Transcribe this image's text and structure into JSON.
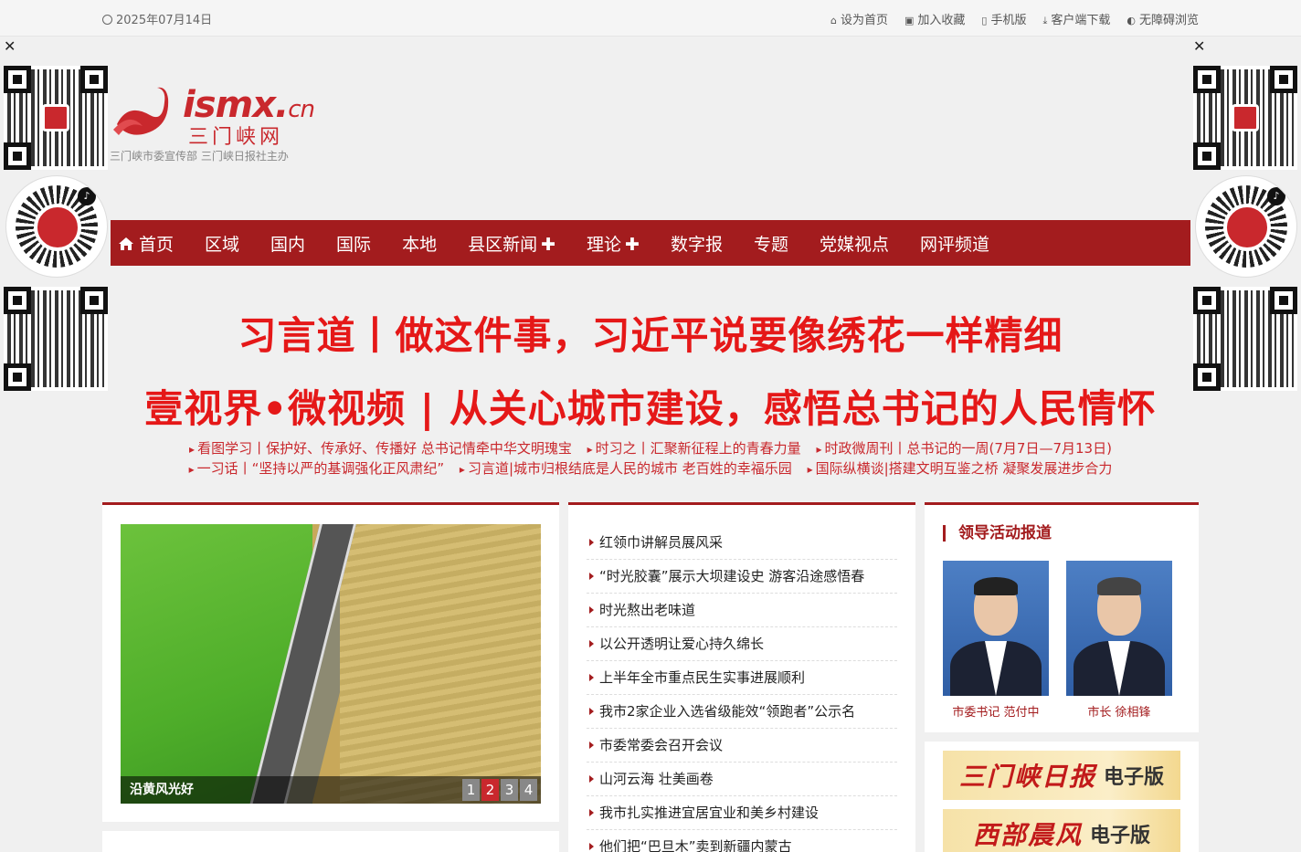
{
  "topbar": {
    "date": "2025年07月14日",
    "links": [
      {
        "label": "设为首页",
        "icon": "home-icon"
      },
      {
        "label": "加入收藏",
        "icon": "bookmark-icon"
      },
      {
        "label": "手机版",
        "icon": "mobile-icon"
      },
      {
        "label": "客户端下载",
        "icon": "download-icon"
      },
      {
        "label": "无障碍浏览",
        "icon": "accessibility-icon"
      }
    ]
  },
  "side": {
    "close": "✕"
  },
  "logo": {
    "wordmark": "ismx.",
    "tld": "cn",
    "name": "三门峡网",
    "slogan": "三门峡市委宣传部  三门峡日报社主办"
  },
  "nav": {
    "items": [
      {
        "label": "首页",
        "has_plus": false
      },
      {
        "label": "区域",
        "has_plus": false
      },
      {
        "label": "国内",
        "has_plus": false
      },
      {
        "label": "国际",
        "has_plus": false
      },
      {
        "label": "本地",
        "has_plus": false
      },
      {
        "label": "县区新闻",
        "has_plus": true
      },
      {
        "label": "理论",
        "has_plus": true
      },
      {
        "label": "数字报",
        "has_plus": false
      },
      {
        "label": "专题",
        "has_plus": false
      },
      {
        "label": "党媒视点",
        "has_plus": false
      },
      {
        "label": "网评频道",
        "has_plus": false
      }
    ],
    "plus_glyph": "✚"
  },
  "headlines": {
    "h1": "习言道丨做这件事，习近平说要像绣花一样精细",
    "h2": "壹视界•微视频 | 从关心城市建设，感悟总书记的人民情怀"
  },
  "ticker": [
    "看图学习丨保护好、传承好、传播好 总书记情牵中华文明瑰宝",
    "时习之丨汇聚新征程上的青春力量",
    "时政微周刊丨总书记的一周(7月7日—7月13日)",
    "一习话丨“坚持以严的基调强化正风肃纪”",
    "习言道|城市归根结底是人民的城市 老百姓的幸福乐园",
    "国际纵横谈|搭建文明互鉴之桥 凝聚发展进步合力"
  ],
  "slider": {
    "caption": "沿黄风光好",
    "pages": [
      "1",
      "2",
      "3",
      "4"
    ],
    "active_page": 2
  },
  "news": [
    "红领巾讲解员展风采",
    "“时光胶囊”展示大坝建设史 游客沿途感悟春",
    "时光熬出老味道",
    "以公开透明让爱心持久绵长",
    "上半年全市重点民生实事进展顺利",
    "我市2家企业入选省级能效“领跑者”公示名",
    "市委常委会召开会议",
    "山河云海 壮美画卷",
    "我市扎实推进宜居宜业和美乡村建设",
    "他们把“巴旦木”卖到新疆内蒙古"
  ],
  "leaders": {
    "title": "领导活动报道",
    "people": [
      {
        "caption": "市委书记 范付中"
      },
      {
        "caption": "市长 徐相锋"
      }
    ]
  },
  "epapers": [
    {
      "brand": "三门峡日报",
      "suffix": "电子版"
    },
    {
      "brand": "西部晨风",
      "suffix": "电子版"
    }
  ],
  "colors": {
    "brand_red": "#a31c1e",
    "headline_red": "#e51818"
  }
}
